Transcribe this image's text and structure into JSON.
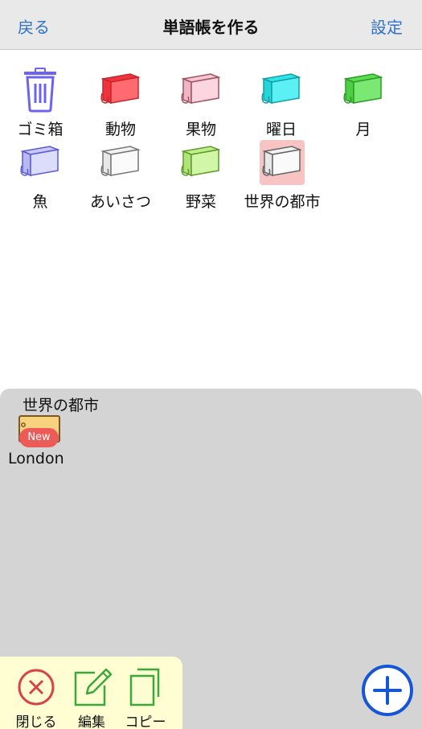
{
  "navbar": {
    "back_label": "戻る",
    "title": "単語帳を作る",
    "settings_label": "設定"
  },
  "decks": [
    {
      "label": "ゴミ箱",
      "icon": "trash-icon",
      "color": "#6c63f0"
    },
    {
      "label": "動物",
      "icon": "card-deck-icon",
      "color": "#f2333b"
    },
    {
      "label": "果物",
      "icon": "card-deck-icon",
      "color": "#f7c5d4"
    },
    {
      "label": "曜日",
      "icon": "card-deck-icon",
      "color": "#2ce6ec"
    },
    {
      "label": "月",
      "icon": "card-deck-icon",
      "color": "#59de4f"
    },
    {
      "label": "魚",
      "icon": "card-deck-icon",
      "color": "#c9c9f7"
    },
    {
      "label": "あいさつ",
      "icon": "card-deck-icon",
      "color": "#f2f2f2"
    },
    {
      "label": "野菜",
      "icon": "card-deck-icon",
      "color": "#bfef8a"
    },
    {
      "label": "世界の都市",
      "icon": "card-deck-icon",
      "color": "#f2f2f2",
      "selected": true
    }
  ],
  "panel": {
    "title": "世界の都市",
    "cards": [
      {
        "label": "London",
        "badge": "New",
        "icon": "card-icon",
        "color": "#f9d27f"
      }
    ]
  },
  "toolbar": {
    "close_label": "閉じる",
    "edit_label": "編集",
    "copy_label": "コピー"
  },
  "colors": {
    "accent": "#2f73c9",
    "add_button": "#1556d6",
    "close_icon": "#d8434b",
    "edit_icon": "#3aa83a",
    "panel_bg": "#d4d4d4",
    "toolbar_bg": "#fefed2"
  }
}
